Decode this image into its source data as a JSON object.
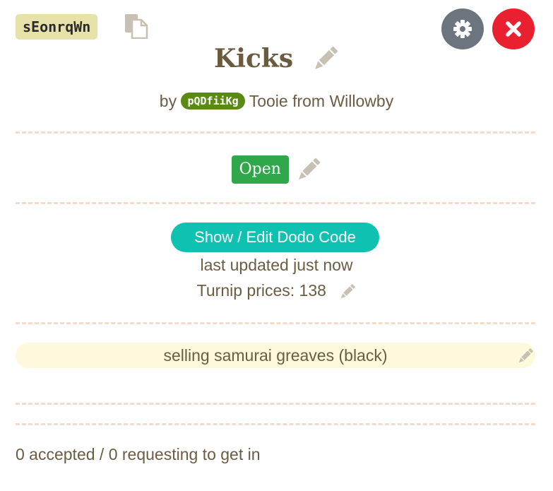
{
  "header": {
    "island_code": "sEonrqWn",
    "copy_icon": "copy-icon",
    "settings_icon": "gear-icon",
    "close_icon": "close-icon"
  },
  "listing": {
    "title": "Kicks",
    "by_prefix": "by",
    "user_code": "pQDfiiKg",
    "owner": "Tooie from Willowby",
    "status": "Open",
    "dodo_button": "Show / Edit Dodo Code",
    "last_updated": "last updated just now",
    "turnip_label": "Turnip prices:",
    "turnip_value": "138",
    "note": "selling samurai greaves (black)",
    "footer": "0 accepted / 0 requesting to get in"
  },
  "colors": {
    "id_badge": "#e6e2a9",
    "user_badge": "#5a8a12",
    "status_open": "#2ea84a",
    "dodo_button": "#0fc1b1",
    "close_button": "#e8202f",
    "settings_button": "#6c757d",
    "note_bg": "#fef8dc",
    "divider": "#f3dccc"
  }
}
